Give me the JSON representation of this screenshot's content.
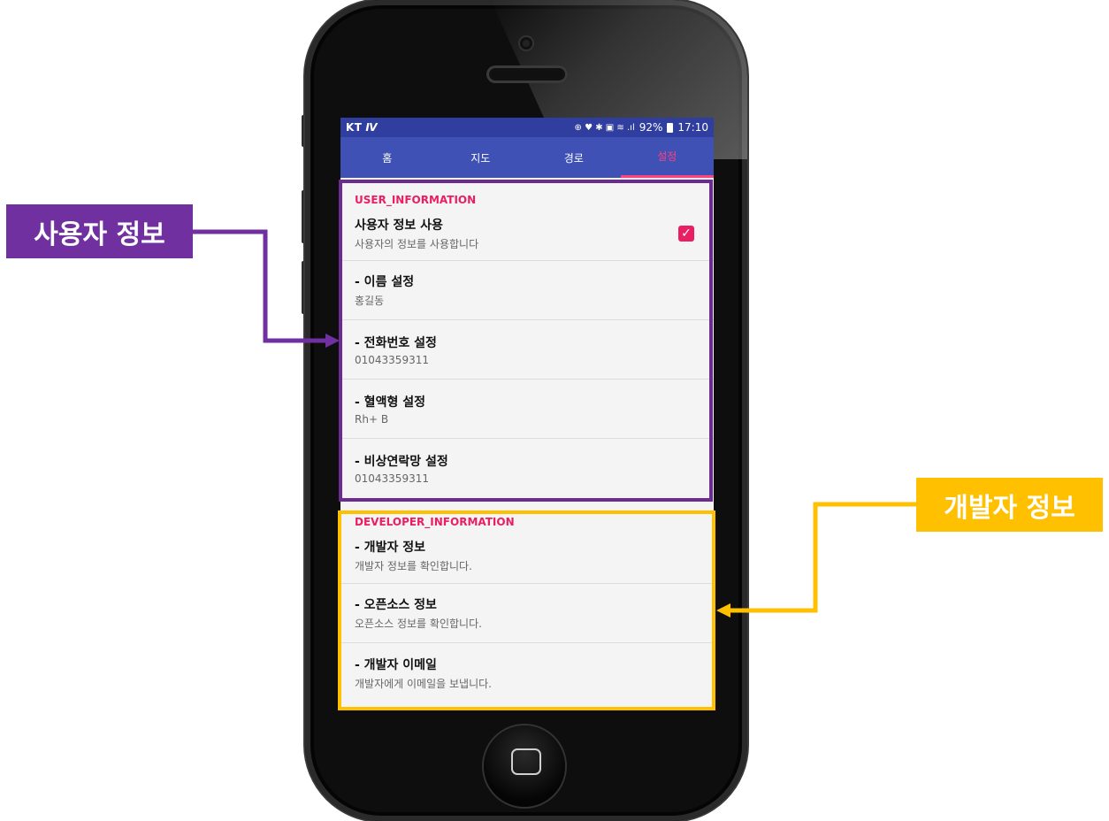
{
  "status_bar": {
    "carrier": "KT",
    "icons": "⊕ ♥ ✱ ▣ ≋ .ıl",
    "battery": "92%",
    "time": "17:10"
  },
  "tabs": [
    {
      "label": "홈",
      "active": false
    },
    {
      "label": "지도",
      "active": false
    },
    {
      "label": "경로",
      "active": false
    },
    {
      "label": "설정",
      "active": true
    }
  ],
  "user_section": {
    "header": "USER_INFORMATION",
    "items": [
      {
        "title": "사용자 정보 사용",
        "summary": "사용자의 정보를 사용합니다",
        "checked": true
      },
      {
        "title": "- 이름 설정",
        "summary": "홍길동"
      },
      {
        "title": "- 전화번호 설정",
        "summary": "01043359311"
      },
      {
        "title": "- 혈액형 설정",
        "summary": "Rh+ B"
      },
      {
        "title": "- 비상연락망 설정",
        "summary": "01043359311"
      }
    ]
  },
  "developer_section": {
    "header": "DEVELOPER_INFORMATION",
    "items": [
      {
        "title": "- 개발자 정보",
        "summary": "개발자 정보를 확인합니다."
      },
      {
        "title": "- 오픈소스 정보",
        "summary": "오픈소스 정보를 확인합니다."
      },
      {
        "title": "- 개발자 이메일",
        "summary": "개발자에게 이메일을 보냅니다."
      }
    ]
  },
  "callouts": {
    "user_label": "사용자 정보",
    "developer_label": "개발자 정보",
    "user_color": "#7030a0",
    "developer_color": "#ffc000"
  },
  "colors": {
    "app_bar": "#3f51b5",
    "status_bar": "#303f9f",
    "accent": "#e91e63"
  }
}
